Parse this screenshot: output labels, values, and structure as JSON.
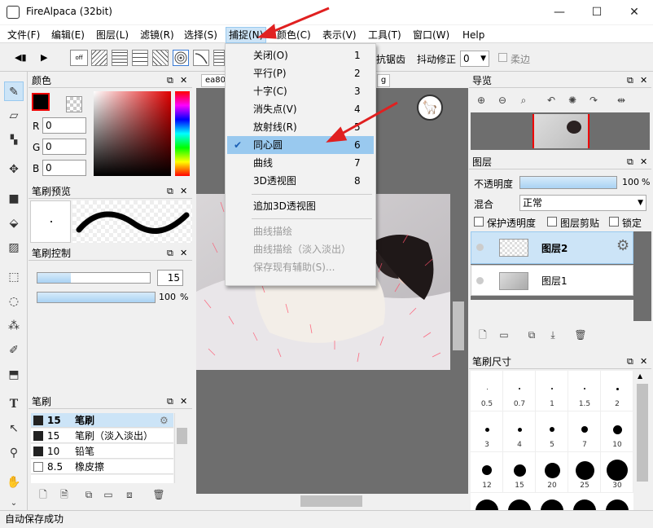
{
  "window": {
    "title": "FireAlpaca (32bit)",
    "minimize": "—",
    "maximize": "☐",
    "close": "✕"
  },
  "menubar": [
    "文件(F)",
    "编辑(E)",
    "图层(L)",
    "滤镜(R)",
    "选择(S)",
    "捕捉(N)",
    "颜色(C)",
    "表示(V)",
    "工具(T)",
    "窗口(W)",
    "Help"
  ],
  "toolbar": {
    "off_label": "off",
    "antialias": "抗锯齿",
    "stabilizer_label": "抖动修正",
    "stabilizer_value": "0",
    "soft_label": "柔边"
  },
  "snap_menu": {
    "items": [
      {
        "label": "关闭(O)",
        "key": "1"
      },
      {
        "label": "平行(P)",
        "key": "2"
      },
      {
        "label": "十字(C)",
        "key": "3"
      },
      {
        "label": "消失点(V)",
        "key": "4"
      },
      {
        "label": "放射线(R)",
        "key": "5"
      },
      {
        "label": "同心圆",
        "key": "6",
        "checked": true
      },
      {
        "label": "曲线",
        "key": "7"
      },
      {
        "label": "3D透视图",
        "key": "8"
      }
    ],
    "add3d": "追加3D透视图",
    "disabled": [
      "曲线描绘",
      "曲线描绘（淡入淡出）",
      "保存现有辅助(S)..."
    ]
  },
  "tab": {
    "left": "ea80",
    "right": "g"
  },
  "color_panel": {
    "title": "颜色",
    "r_label": "R",
    "g_label": "G",
    "b_label": "B",
    "r": "0",
    "g": "0",
    "b": "0"
  },
  "brush_preview": {
    "title": "笔刷预览"
  },
  "brush_control": {
    "title": "笔刷控制",
    "size": "15",
    "opacity": "100",
    "opacity_unit": "%"
  },
  "brush_panel": {
    "title": "笔刷",
    "rows": [
      {
        "size": "15",
        "name": "笔刷",
        "selected": true
      },
      {
        "size": "15",
        "name": "笔刷（淡入淡出）"
      },
      {
        "size": "10",
        "name": "铅笔"
      },
      {
        "size": "8.5",
        "name": "橡皮擦"
      }
    ]
  },
  "navigator": {
    "title": "导览"
  },
  "layer_panel": {
    "title": "图层",
    "opacity_label": "不透明度",
    "opacity_value": "100",
    "opacity_unit": "%",
    "blend_label": "混合",
    "blend_value": "正常",
    "protect": "保护透明度",
    "clip": "图层剪贴",
    "lock": "锁定",
    "layers": [
      "图层2",
      "图层1"
    ]
  },
  "brush_size": {
    "title": "笔刷尺寸",
    "sizes": [
      "0.5",
      "0.7",
      "1",
      "1.5",
      "2",
      "3",
      "4",
      "5",
      "7",
      "10",
      "12",
      "15",
      "20",
      "25",
      "30"
    ]
  },
  "status": "自动保存成功",
  "colors": {
    "accent": "#99c9ef",
    "highlight": "#cce4f7",
    "arrow": "#e02020",
    "canvas_bg": "#6e6e6e"
  }
}
